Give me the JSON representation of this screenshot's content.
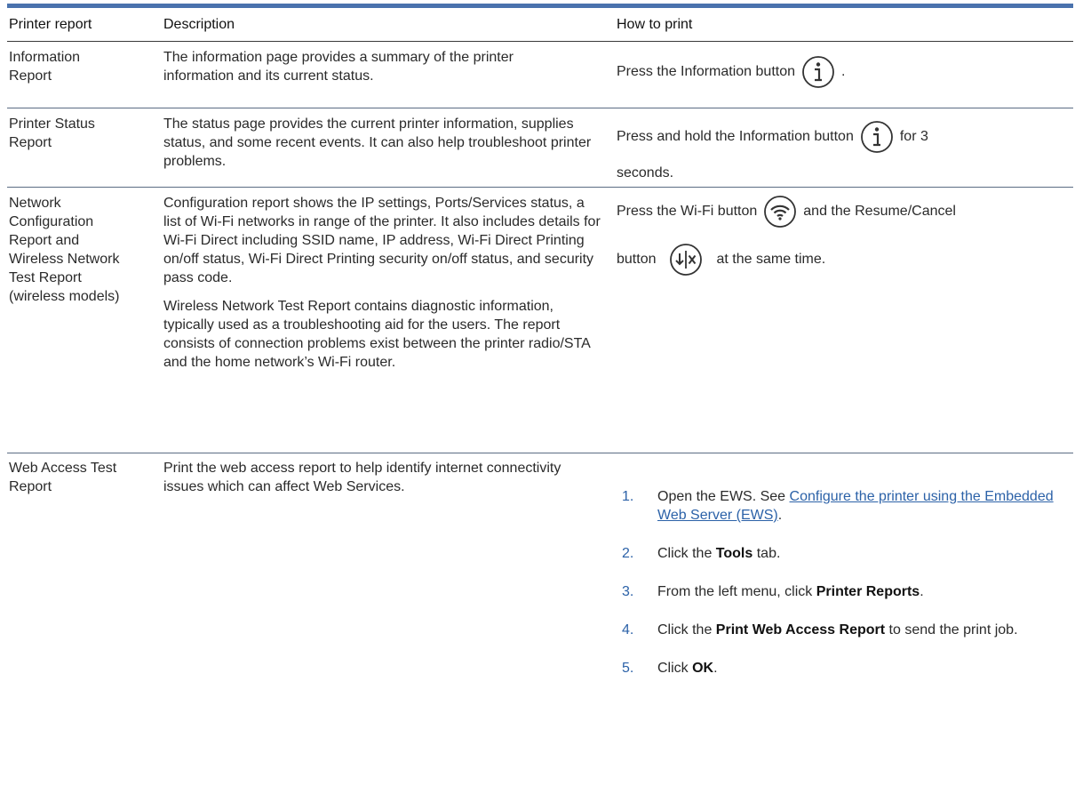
{
  "columns": [
    "Printer report",
    "Description",
    "How to print"
  ],
  "rows": {
    "info": {
      "report": "Information Report",
      "description": "The information page provides a summary of the printer information and its current status.",
      "how_before": "Press the Information button",
      "how_after": ".",
      "icon": "information-icon"
    },
    "status": {
      "report": "Printer Status Report",
      "description": "The status page provides the current printer information, supplies status, and some recent events. It can also help troubleshoot printer problems.",
      "how_before": "Press and hold the Information button",
      "how_after": "for 3",
      "how_line2": "seconds.",
      "icon": "information-icon"
    },
    "network": {
      "report": "Network Configuration Report and Wireless Network Test Report (wireless models)",
      "description_1": "Configuration report shows the IP settings, Ports/Services status, a list of Wi-Fi networks in range of the printer. It also includes details for Wi-Fi Direct including SSID name, IP address, Wi-Fi Direct Printing on/off status, Wi-Fi Direct Printing security on/off status, and security pass code.",
      "description_2": "Wireless Network Test Report contains diagnostic information, typically used as a troubleshooting aid for the users. The report consists of connection problems exist between the printer radio/STA and the home network’s Wi-Fi router.",
      "how_l1_before": "Press the Wi-Fi button",
      "how_l1_after": "and the Resume/Cancel",
      "how_l2_before": "button",
      "how_l2_after": "at the same time.",
      "icons": [
        "wifi-icon",
        "resume-cancel-icon"
      ]
    },
    "web": {
      "report": "Web Access Test Report",
      "description": "Print the web access report to help identify internet connectivity issues which can affect Web Services.",
      "steps": [
        {
          "num": "1.",
          "pre": "Open the EWS. See ",
          "link": "Configure the printer using the Embedded Web Server (EWS)",
          "post": "."
        },
        {
          "num": "2.",
          "pre": "Click the ",
          "bold": "Tools",
          "post": " tab."
        },
        {
          "num": "3.",
          "pre": "From the left menu, click ",
          "bold": "Printer Reports",
          "post": "."
        },
        {
          "num": "4.",
          "pre": "Click the ",
          "bold": "Print Web Access Report",
          "post": " to send the print job."
        },
        {
          "num": "5.",
          "pre": "Click ",
          "bold": "OK",
          "post": "."
        }
      ]
    }
  },
  "colors": {
    "accent": "#4a72ad",
    "link": "#2c62a8"
  }
}
